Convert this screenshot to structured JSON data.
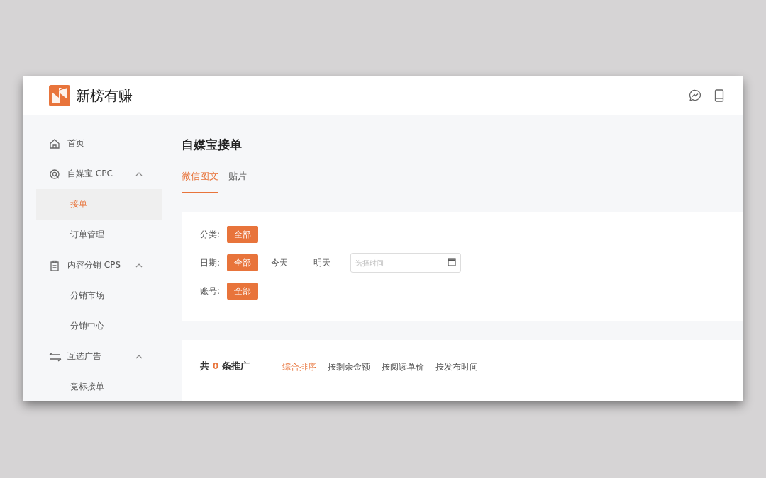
{
  "header": {
    "brand": "新榜有赚"
  },
  "sidebar": {
    "items": [
      {
        "label": "首页",
        "selected": false
      },
      {
        "label": "自媒宝 CPC",
        "expanded": true,
        "selected": false,
        "children": [
          {
            "label": "接单",
            "selected": true
          },
          {
            "label": "订单管理",
            "selected": false
          }
        ]
      },
      {
        "label": "内容分销 CPS",
        "expanded": true,
        "selected": false,
        "children": [
          {
            "label": "分销市场",
            "selected": false
          },
          {
            "label": "分销中心",
            "selected": false
          }
        ]
      },
      {
        "label": "互选广告",
        "expanded": true,
        "selected": false,
        "children": [
          {
            "label": "竞标接单",
            "selected": false
          }
        ]
      }
    ]
  },
  "page": {
    "title": "自媒宝接单"
  },
  "tabs": [
    {
      "label": "微信图文",
      "selected": true
    },
    {
      "label": "贴片",
      "selected": false
    }
  ],
  "filters": [
    {
      "label": "分类:",
      "options": [
        {
          "label": "全部",
          "selected": true
        }
      ]
    },
    {
      "label": "日期:",
      "options": [
        {
          "label": "全部",
          "selected": true
        },
        {
          "label": "今天",
          "selected": false
        },
        {
          "label": "明天",
          "selected": false
        }
      ],
      "date_field": {
        "placeholder": "选择时间"
      }
    },
    {
      "label": "账号:",
      "options": [
        {
          "label": "全部",
          "selected": true
        }
      ]
    }
  ],
  "results": {
    "prefix": "共",
    "count": "0",
    "suffix": "条推广",
    "sort_options": [
      {
        "label": "综合排序",
        "selected": true
      },
      {
        "label": "按剩余金额",
        "selected": false
      },
      {
        "label": "按阅读单价",
        "selected": false
      },
      {
        "label": "按发布时间",
        "selected": false
      }
    ]
  }
}
